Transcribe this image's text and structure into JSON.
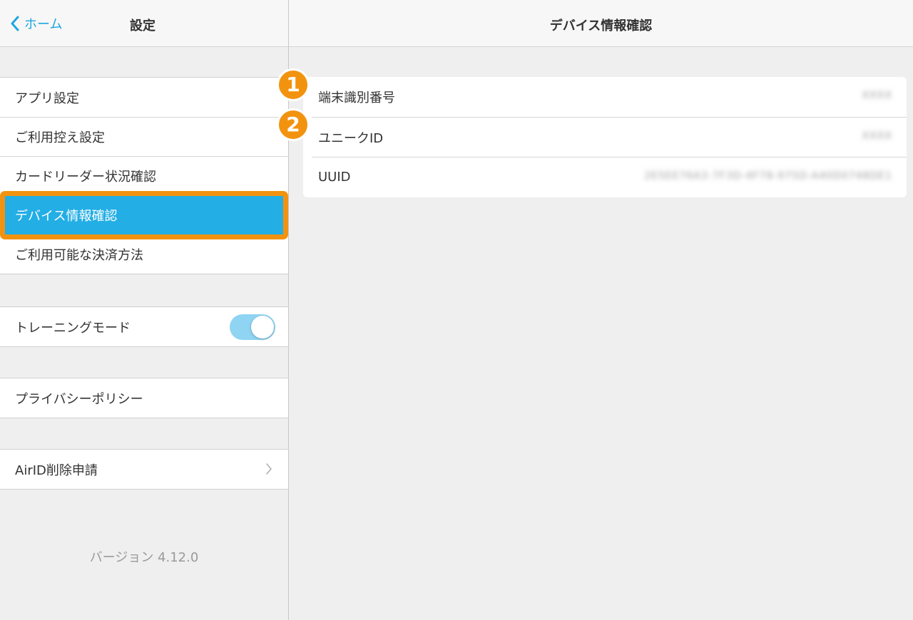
{
  "left_header": {
    "back_label": "ホーム",
    "title": "設定"
  },
  "menu": {
    "items": [
      {
        "label": "アプリ設定"
      },
      {
        "label": "ご利用控え設定"
      },
      {
        "label": "カードリーダー状況確認"
      },
      {
        "label": "デバイス情報確認",
        "selected": true
      },
      {
        "label": "ご利用可能な決済方法"
      }
    ]
  },
  "training": {
    "label": "トレーニングモード",
    "toggle_on": true
  },
  "privacy": {
    "label": "プライバシーポリシー"
  },
  "airid": {
    "label": "AirID削除申請",
    "icon": "chevron-right-icon"
  },
  "version": "バージョン 4.12.0",
  "right_header": {
    "title": "デバイス情報確認"
  },
  "device_info": {
    "rows": [
      {
        "label": "端末識別番号",
        "value": "XXXX",
        "badge": "1"
      },
      {
        "label": "ユニークID",
        "value": "XXXX",
        "badge": "2"
      },
      {
        "label": "UUID",
        "value": "2E5EE76A3-7F3D-4F78-975D-A40D0748DE1"
      }
    ]
  },
  "colors": {
    "accent": "#1ea7e0",
    "selected_bg": "#23aee5",
    "highlight_orange": "#f2930f",
    "toggle_on": "#8fd4f2"
  }
}
